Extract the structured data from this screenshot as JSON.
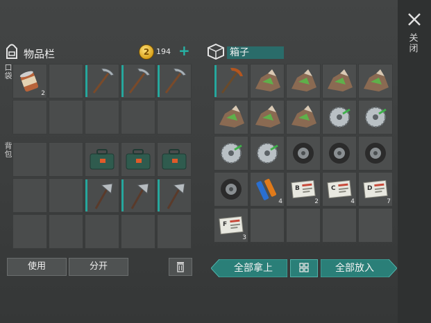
{
  "inventory": {
    "title": "物品栏",
    "coins": "194",
    "pockets_label": "口袋",
    "backpack_label": "背包"
  },
  "box": {
    "title": "箱子"
  },
  "close_label": "关闭",
  "buttons": {
    "use": "使用",
    "split": "分开",
    "take_all": "全部拿上",
    "put_all": "全部放入"
  },
  "pocket_slots": [
    {
      "item": "canned-food",
      "count": "2"
    },
    {
      "item": "empty",
      "count": ""
    },
    {
      "item": "pickaxe",
      "count": ""
    },
    {
      "item": "pickaxe",
      "count": ""
    },
    {
      "item": "pickaxe",
      "count": ""
    },
    {
      "item": "empty",
      "count": ""
    },
    {
      "item": "empty",
      "count": ""
    },
    {
      "item": "empty",
      "count": ""
    },
    {
      "item": "empty",
      "count": ""
    },
    {
      "item": "empty",
      "count": ""
    }
  ],
  "backpack_slots": [
    {
      "item": "empty",
      "count": ""
    },
    {
      "item": "empty",
      "count": ""
    },
    {
      "item": "toolbox",
      "count": ""
    },
    {
      "item": "toolbox",
      "count": ""
    },
    {
      "item": "toolbox",
      "count": ""
    },
    {
      "item": "empty",
      "count": ""
    },
    {
      "item": "empty",
      "count": ""
    },
    {
      "item": "hatchet",
      "count": ""
    },
    {
      "item": "hatchet",
      "count": ""
    },
    {
      "item": "hatchet",
      "count": ""
    },
    {
      "item": "empty",
      "count": ""
    },
    {
      "item": "empty",
      "count": ""
    },
    {
      "item": "empty",
      "count": ""
    },
    {
      "item": "empty",
      "count": ""
    },
    {
      "item": "empty",
      "count": ""
    }
  ],
  "box_slots": [
    {
      "item": "rusty-pickaxe",
      "count": ""
    },
    {
      "item": "scrap-pile",
      "count": ""
    },
    {
      "item": "scrap-pile",
      "count": ""
    },
    {
      "item": "scrap-pile",
      "count": ""
    },
    {
      "item": "scrap-pile",
      "count": ""
    },
    {
      "item": "scrap-pile",
      "count": ""
    },
    {
      "item": "scrap-pile",
      "count": ""
    },
    {
      "item": "scrap-pile",
      "count": ""
    },
    {
      "item": "saw-blade",
      "count": ""
    },
    {
      "item": "saw-blade",
      "count": ""
    },
    {
      "item": "saw-blade",
      "count": ""
    },
    {
      "item": "saw-blade",
      "count": ""
    },
    {
      "item": "tire",
      "count": ""
    },
    {
      "item": "tire",
      "count": ""
    },
    {
      "item": "tire",
      "count": ""
    },
    {
      "item": "tire",
      "count": ""
    },
    {
      "item": "batteries",
      "count": "4"
    },
    {
      "item": "card-b",
      "count": "2",
      "letter": "B"
    },
    {
      "item": "card-c",
      "count": "4",
      "letter": "C"
    },
    {
      "item": "card-d",
      "count": "7",
      "letter": "D"
    },
    {
      "item": "card-f",
      "count": "3",
      "letter": "F"
    },
    {
      "item": "empty",
      "count": ""
    },
    {
      "item": "empty",
      "count": ""
    },
    {
      "item": "empty",
      "count": ""
    },
    {
      "item": "empty",
      "count": ""
    }
  ],
  "colors": {
    "accent": "#2a7f78",
    "plus": "#27b3a6",
    "slot": "#4a4c4c"
  }
}
